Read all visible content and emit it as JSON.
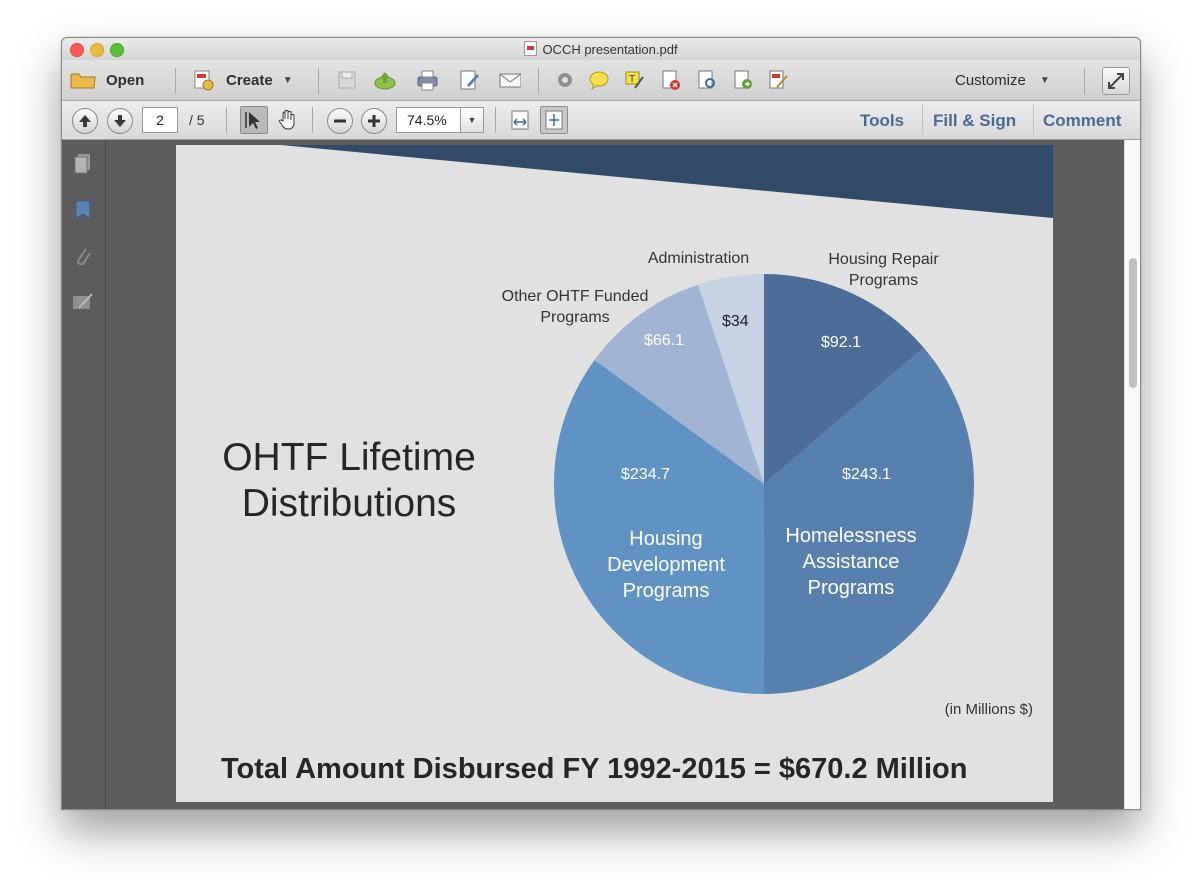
{
  "window": {
    "title": "OCCH presentation.pdf"
  },
  "toolbar": {
    "open_label": "Open",
    "create_label": "Create",
    "customize_label": "Customize",
    "icons": [
      "save-icon",
      "upload-icon",
      "print-icon",
      "edit-icon",
      "email-icon",
      "gear-icon",
      "comment-icon",
      "highlight-icon",
      "delete-page-icon",
      "search-doc-icon",
      "export-icon",
      "sign-icon"
    ]
  },
  "nav": {
    "current_page": "2",
    "total_pages": "/ 5",
    "zoom": "74.5%",
    "tools_label": "Tools",
    "fill_sign_label": "Fill & Sign",
    "comment_label": "Comment"
  },
  "slide": {
    "title_line1": "OHTF Lifetime",
    "title_line2": "Distributions",
    "note": "(in Millions $)",
    "footer": "Total Amount Disbursed FY 1992-2015 = $670.2 Million"
  },
  "chart_data": {
    "type": "pie",
    "title": "OHTF Lifetime Distributions",
    "unit_note": "(in Millions $)",
    "slices": [
      {
        "label": "Housing Repair Programs",
        "value": 92.1,
        "value_label": "$92.1",
        "color": "#4b6d97"
      },
      {
        "label": "Homelessness Assistance Programs",
        "value": 243.1,
        "value_label": "$243.1",
        "color": "#5880ae"
      },
      {
        "label": "Housing Development Programs",
        "value": 234.7,
        "value_label": "$234.7",
        "color": "#6092c3"
      },
      {
        "label": "Other OHTF Funded Programs",
        "value": 66.1,
        "value_label": "$66.1",
        "color": "#a2b4d3"
      },
      {
        "label": "Administration",
        "value": 34,
        "value_label": "$34",
        "color": "#c7d2e4"
      }
    ],
    "outside_labels": {
      "housing_repair_line1": "Housing Repair",
      "housing_repair_line2": "Programs",
      "administration": "Administration",
      "other_line1": "Other OHTF Funded",
      "other_line2": "Programs"
    },
    "inside_labels": {
      "homelessness_line1": "Homelessness",
      "homelessness_line2": "Assistance",
      "homelessness_line3": "Programs",
      "development_line1": "Housing",
      "development_line2": "Development",
      "development_line3": "Programs"
    }
  }
}
